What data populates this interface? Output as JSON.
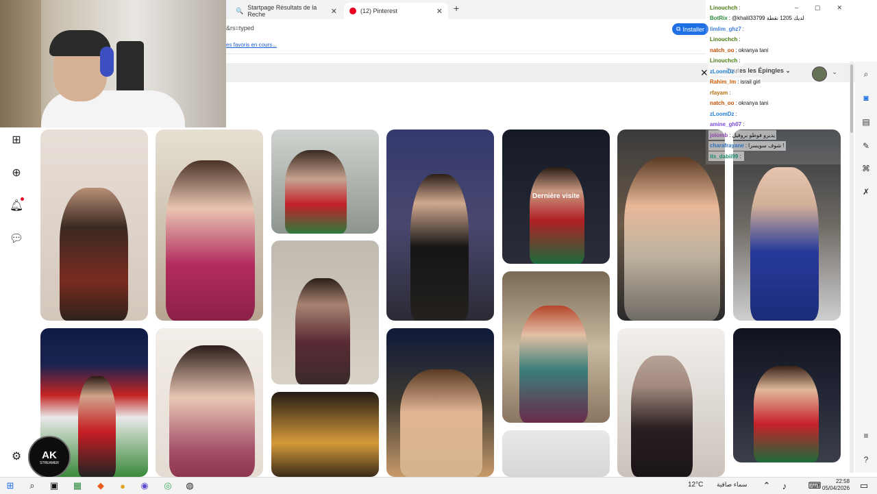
{
  "browser": {
    "tabs": [
      {
        "label": "Startpage Résultats de la Reche",
        "favicon": "search-icon"
      },
      {
        "label": "(12) Pinterest",
        "favicon": "pinterest-icon"
      }
    ],
    "address_text": "&rs=typed",
    "install_label": "Installer",
    "bookmarks_text": "es favoris en cours...",
    "pin_filter_label": "Toutes les Épingles"
  },
  "pin_grid": {
    "last_visit_label": "Dernière visite"
  },
  "chat": [
    {
      "user": "Linouchch",
      "msg": "",
      "user_color": "#4a7b12"
    },
    {
      "user": "BotRix",
      "msg": "@khalil33799 لديك 1205 نقطة",
      "user_color": "#2b8a3e"
    },
    {
      "user": "limlim_ghz7",
      "msg": "",
      "user_color": "#3f7fd6"
    },
    {
      "user": "Linouchch",
      "msg": "",
      "user_color": "#4a7b12"
    },
    {
      "user": "natch_oo",
      "msg": "okranya tani",
      "user_color": "#c24b00"
    },
    {
      "user": "Linouchch",
      "msg": "",
      "user_color": "#4a7b12"
    },
    {
      "user": "zLoomDz",
      "msg": "",
      "user_color": "#1f7dd4"
    },
    {
      "user": "Rahim_lm",
      "msg": "israil girl",
      "user_color": "#d35a00"
    },
    {
      "user": "rfayam",
      "msg": "",
      "user_color": "#b06e0a"
    },
    {
      "user": "natch_oo",
      "msg": "okranya tani",
      "user_color": "#c24b00"
    },
    {
      "user": "zLoomDz",
      "msg": "",
      "user_color": "#1f7dd4"
    },
    {
      "user": "amine_gh07",
      "msg": "",
      "user_color": "#7a4bd6"
    },
    {
      "user": "jolomb",
      "msg": "يديرو فوطو بروفيل",
      "user_color": "#8e44ad"
    },
    {
      "user": "charafrayane",
      "msg": "شوف سويسرا !",
      "user_color": "#2c6fbf"
    },
    {
      "user": "its_dabii99",
      "msg": "",
      "user_color": "#1b8a6b"
    }
  ],
  "taskbar": {
    "temperature": "12°C",
    "weather_text": "سماء صافية",
    "time": "22:58",
    "date": "05/04/2026"
  },
  "colors": {
    "accent_blue": "#1f6fe5",
    "notification_red": "#e60023"
  },
  "branding": {
    "stream_logo": "AK",
    "stream_logo_sub": "STREAMER"
  }
}
